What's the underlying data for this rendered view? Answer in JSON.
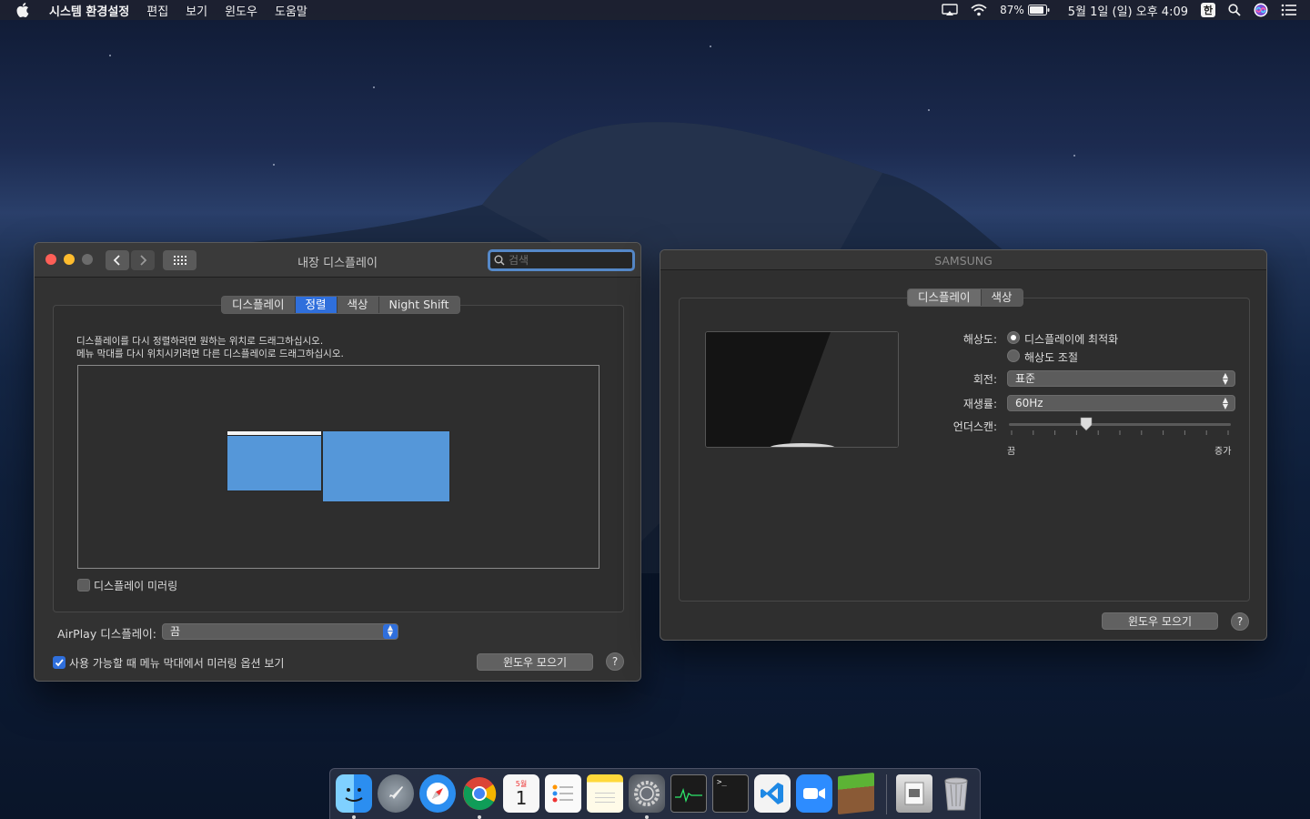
{
  "menubar": {
    "app_name": "시스템 환경설정",
    "items": [
      "편집",
      "보기",
      "윈도우",
      "도움말"
    ],
    "battery": "87%",
    "clock": "5월 1일 (일) 오후  4:09",
    "input_source": "한"
  },
  "window_left": {
    "title": "내장 디스플레이",
    "search_placeholder": "검색",
    "tabs": [
      "디스플레이",
      "정렬",
      "색상",
      "Night Shift"
    ],
    "active_tab": "정렬",
    "instruction_line1": "디스플레이를 다시 정렬하려면 원하는 위치로 드래그하십시오.",
    "instruction_line2": "메뉴 막대를 다시 위치시키려면 다른 디스플레이로 드래그하십시오.",
    "mirror_label": "디스플레이 미러링",
    "mirror_checked": false,
    "airplay_label": "AirPlay 디스플레이:",
    "airplay_value": "끔",
    "menu_option_label": "사용 가능할 때 메뉴 막대에서 미러링 옵션 보기",
    "menu_option_checked": true,
    "gather_button": "윈도우 모으기",
    "help": "?"
  },
  "window_right": {
    "title": "SAMSUNG",
    "tabs": [
      "디스플레이",
      "색상"
    ],
    "active_tab": "디스플레이",
    "resolution_label": "해상도:",
    "resolution_options": [
      "디스플레이에 최적화",
      "해상도 조절"
    ],
    "resolution_selected": "디스플레이에 최적화",
    "rotation_label": "회전:",
    "rotation_value": "표준",
    "refresh_label": "재생률:",
    "refresh_value": "60Hz",
    "underscan_label": "언더스캔:",
    "underscan_min": "끔",
    "underscan_max": "증가",
    "underscan_level": 0.34,
    "gather_button": "윈도우 모으기",
    "help": "?"
  },
  "dock": {
    "apps": [
      "finder-icon",
      "launchpad-icon",
      "safari-icon",
      "chrome-icon",
      "calendar-icon",
      "reminders-icon",
      "notes-icon",
      "system-preferences-icon",
      "activity-monitor-icon",
      "terminal-icon",
      "vscode-icon",
      "zoom-icon",
      "minecraft-icon",
      "preview-icon",
      "trash-icon"
    ],
    "calendar_month": "5월",
    "calendar_day": "1"
  },
  "colors": {
    "accent": "#2f6fdc",
    "display_blue": "#5597d9",
    "window_bg": "#323232"
  }
}
